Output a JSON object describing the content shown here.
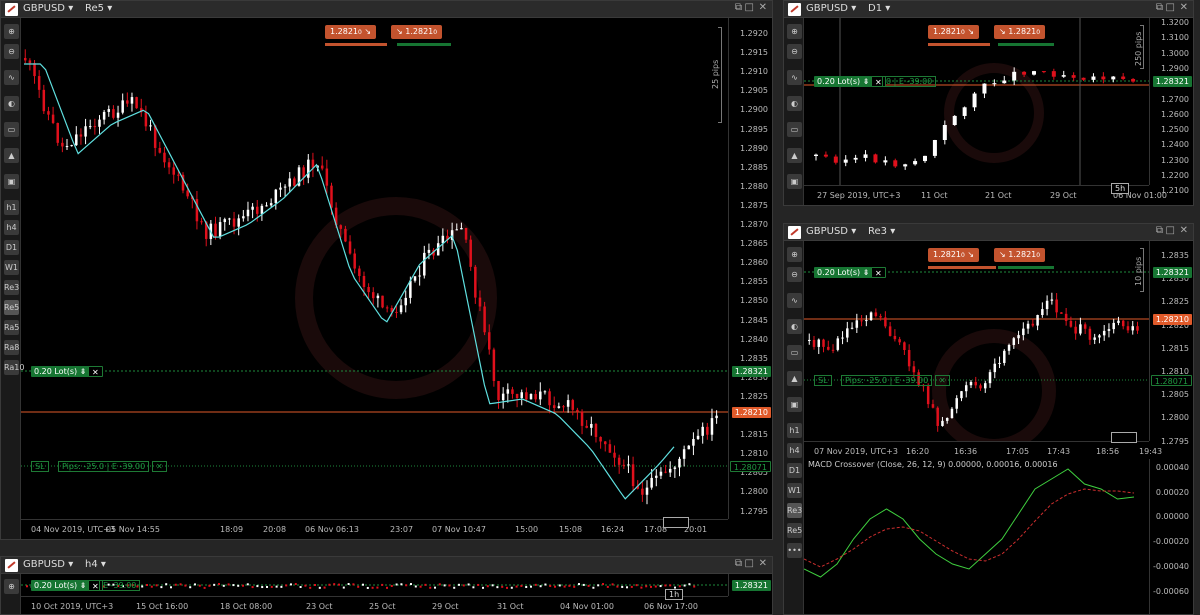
{
  "colors": {
    "bull": "#ffffff",
    "bear": "#e0101c",
    "ema": "#5fe0e0",
    "price_line": "#e05a2a",
    "pos_line": "#1e8a3c"
  },
  "main": {
    "symbol": "GBPUSD",
    "timeframe": "Re5",
    "sell_price": "1.2821",
    "sell_price_sub": "0",
    "buy_price": "1.2821",
    "buy_price_sub": "0",
    "position_label": "0.20 Lot(s)",
    "sl_label": "SL",
    "sl_info": "Pips: -25.0 | E -39.00",
    "pips_label": "25 pips",
    "price_badge": "1.28210",
    "pos_badge": "1.28321",
    "sl_badge": "1.28071",
    "yticks": [
      "1.2920",
      "1.2915",
      "1.2910",
      "1.2905",
      "1.2900",
      "1.2895",
      "1.2890",
      "1.2885",
      "1.2880",
      "1.2875",
      "1.2870",
      "1.2865",
      "1.2860",
      "1.2855",
      "1.2850",
      "1.2845",
      "1.2840",
      "1.2835",
      "1.2830",
      "1.2825",
      "1.2820",
      "1.2815",
      "1.2810",
      "1.2805",
      "1.2800",
      "1.2795"
    ],
    "xticks": [
      "04 Nov 2019, UTC+3",
      "05 Nov 14:55",
      "18:09",
      "20:08",
      "06 Nov 06:13",
      "23:07",
      "07 Nov 10:47",
      "15:00",
      "15:08",
      "16:24",
      "17:08",
      "20:01"
    ],
    "tf_box": "",
    "toolbar": [
      "h1",
      "h4",
      "D1",
      "W1",
      "Re3",
      "Re5",
      "Ra5",
      "Ra8",
      "Ra10"
    ]
  },
  "d1": {
    "symbol": "GBPUSD",
    "timeframe": "D1",
    "sell_price": "1.2821",
    "sell_price_sub": "0",
    "buy_price": "1.2821",
    "buy_price_sub": "0",
    "position_label": "0.20 Lot(s)",
    "pos_info": "0 | E -39.00",
    "pips_label": "250 pips",
    "pos_badge": "1.28321",
    "yticks": [
      "1.3200",
      "1.3100",
      "1.3000",
      "1.2900",
      "1.2800",
      "1.2700",
      "1.2600",
      "1.2500",
      "1.2400",
      "1.2300",
      "1.2200",
      "1.2100"
    ],
    "xticks": [
      "27 Sep 2019, UTC+3",
      "11 Oct",
      "21 Oct",
      "29 Oct",
      "06 Nov 01:00"
    ],
    "tf_box": "5h"
  },
  "re3": {
    "symbol": "GBPUSD",
    "timeframe": "Re3",
    "sell_price": "1.2821",
    "sell_price_sub": "0",
    "buy_price": "1.2821",
    "buy_price_sub": "0",
    "position_label": "0.20 Lot(s)",
    "sl_label": "SL",
    "sl_info": "Pips: -25.0 | E -39.00",
    "pips_label": "10 pips",
    "pos_badge": "1.28321",
    "price_badge": "1.28210",
    "sl_badge": "1.28071",
    "yticks": [
      "1.2835",
      "1.2830",
      "1.2825",
      "1.2820",
      "1.2815",
      "1.2810",
      "1.2805",
      "1.2800",
      "1.2795"
    ],
    "xticks": [
      "07 Nov 2019, UTC+3",
      "16:20",
      "16:36",
      "17:05",
      "17:43",
      "18:56",
      "19:43"
    ],
    "macd_label": "MACD Crossover (Close, 26, 12, 9) 0.00000, 0.00016, 0.00016",
    "macd_yticks": [
      "0.00040",
      "0.00020",
      "0.00000",
      "-0.00020",
      "-0.00040",
      "-0.00060"
    ],
    "toolbar": [
      "h1",
      "h4",
      "D1",
      "W1",
      "Re3",
      "Re5"
    ]
  },
  "h4": {
    "symbol": "GBPUSD",
    "timeframe": "h4",
    "position_label": "0.20 Lot(s)",
    "pos_info": "E -39.00",
    "pos_badge": "1.28321",
    "xticks": [
      "10 Oct 2019, UTC+3",
      "15 Oct 16:00",
      "18 Oct 08:00",
      "23 Oct",
      "25 Oct",
      "29 Oct",
      "31 Oct",
      "04 Nov 01:00",
      "06 Nov 17:00"
    ],
    "tf_box": "1h"
  },
  "chart_data": [
    {
      "type": "candlestick",
      "title": "GBPUSD Re5",
      "ylim": [
        1.2793,
        1.2923
      ]
    },
    {
      "type": "candlestick",
      "title": "GBPUSD D1",
      "ylim": [
        1.215,
        1.323
      ]
    },
    {
      "type": "candlestick",
      "title": "GBPUSD Re3",
      "ylim": [
        1.27915,
        1.28385
      ]
    },
    {
      "type": "line",
      "title": "MACD Crossover (Close, 26, 12, 9)",
      "ylim": [
        -0.00065,
        0.00045
      ]
    }
  ]
}
